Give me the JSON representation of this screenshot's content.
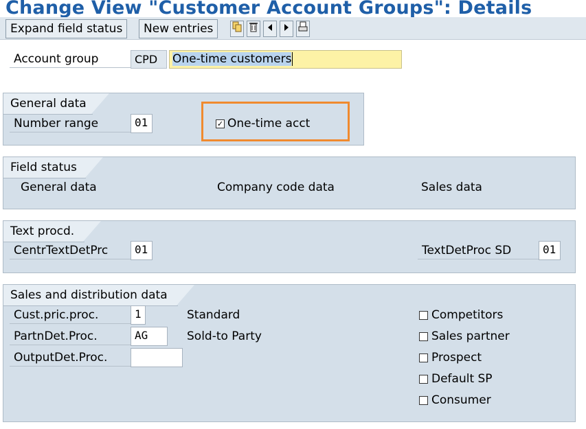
{
  "title": "Change View \"Customer Account Groups\": Details",
  "toolbar": {
    "expand_label": "Expand field status",
    "new_entries_label": "New entries",
    "icons": [
      "copy-icon",
      "delete-icon",
      "previous-entry-icon",
      "next-entry-icon",
      "print-icon"
    ]
  },
  "account_group": {
    "label": "Account group",
    "code": "CPD",
    "description": "One-time customers"
  },
  "general_data": {
    "header": "General data",
    "number_range_label": "Number range",
    "number_range_value": "01",
    "one_time_label": "One-time acct",
    "one_time_checked": true,
    "highlight_color": "#f08a2e"
  },
  "field_status": {
    "header": "Field status",
    "general": "General data",
    "company": "Company code data",
    "sales": "Sales data"
  },
  "text_procd": {
    "header": "Text procd.",
    "centr_label": "CentrTextDetPrc",
    "centr_value": "01",
    "sd_label": "TextDetProc SD",
    "sd_value": "01"
  },
  "sales_dist": {
    "header": "Sales and distribution data",
    "cust_pric_label": "Cust.pric.proc.",
    "cust_pric_value": "1",
    "cust_pric_text": "Standard",
    "partn_label": "PartnDet.Proc.",
    "partn_value": "AG",
    "partn_text": "Sold-to Party",
    "output_label": "OutputDet.Proc.",
    "output_value": "",
    "checkboxes": [
      {
        "label": "Competitors",
        "checked": false
      },
      {
        "label": "Sales partner",
        "checked": false
      },
      {
        "label": "Prospect",
        "checked": false
      },
      {
        "label": "Default SP",
        "checked": false
      },
      {
        "label": "Consumer",
        "checked": false
      }
    ]
  }
}
